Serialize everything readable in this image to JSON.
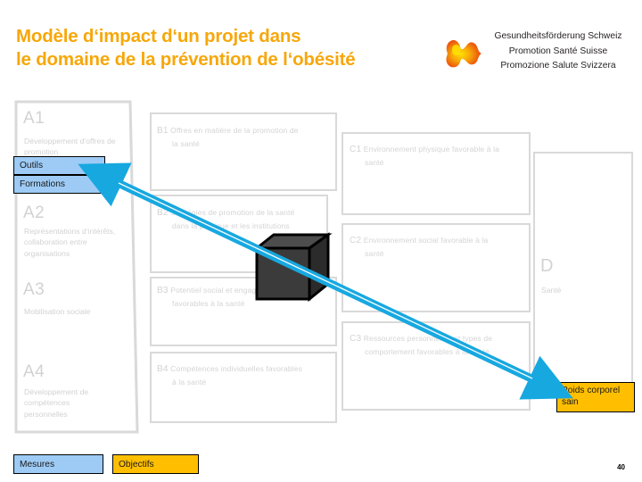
{
  "header": {
    "title_line1": "Modèle d‘impact d‘un projet dans",
    "title_line2": "le domaine de la prévention de l‘obésité",
    "title_color": "#F7A70A",
    "logo": {
      "name": "promotion-sante-suisse-logo",
      "line_de": "Gesundheitsförderung Schweiz",
      "line_fr": "Promotion Santé Suisse",
      "line_it": "Promozione Salute Svizzera",
      "mark_colors": [
        "#E8380D",
        "#F7A70A",
        "#FFE000"
      ]
    }
  },
  "columns": {
    "a": {
      "items": [
        {
          "code": "A1",
          "text": "Développement d‘offres de promotion"
        },
        {
          "code": "A2",
          "text": "Représentations d‘intérêts, collaboration entre organisations"
        },
        {
          "code": "A3",
          "text": "Mobilisation sociale"
        },
        {
          "code": "A4",
          "text": "Développement de compétences personnelles"
        }
      ]
    },
    "b": {
      "items": [
        {
          "code": "B1",
          "line1": "Offres en matière de la promotion de",
          "line2": "la santé"
        },
        {
          "code": "B2",
          "line1": "Stratégies de promotion de la santé",
          "line2": "dans la politique et les institutions"
        },
        {
          "code": "B3",
          "line1": "Potentiel social et engagement",
          "line2": "favorables à la santé"
        },
        {
          "code": "B4",
          "line1": "Compétences individuelles favorables",
          "line2": "à la santé"
        }
      ]
    },
    "c": {
      "items": [
        {
          "code": "C1",
          "line1": "Environnement physique favorable à la",
          "line2": "santé"
        },
        {
          "code": "C2",
          "line1": "Environnement social favorable à la",
          "line2": "santé"
        },
        {
          "code": "C3",
          "line1": "Ressources personnelles et types de",
          "line2": "comportement favorables à la santé"
        }
      ]
    },
    "d": {
      "code": "D",
      "label": "Santé"
    }
  },
  "highlights": [
    {
      "name": "outils",
      "label": "Outils",
      "color": "#9DCBF5"
    },
    {
      "name": "formations",
      "label": "Formations",
      "color": "#9DCBF5"
    },
    {
      "name": "poids-corporel-sain",
      "label_line1": "Poids corporel",
      "label_line2": "sain",
      "color": "#FFBF00"
    }
  ],
  "legend": [
    {
      "name": "mesures",
      "label": "Mesures",
      "color": "#9DCBF5"
    },
    {
      "name": "objectifs",
      "label": "Objectifs",
      "color": "#FFBF00"
    }
  ],
  "annotations": {
    "arrow": {
      "name": "impact-arrow",
      "color": "#17A8E0",
      "direction": "double"
    },
    "cube": {
      "name": "obstacle-cube",
      "face_color": "#3b3b3b",
      "top_color": "#4d4d4d",
      "side_color": "#2b2b2b"
    }
  },
  "footer": {
    "page_number": "40"
  }
}
